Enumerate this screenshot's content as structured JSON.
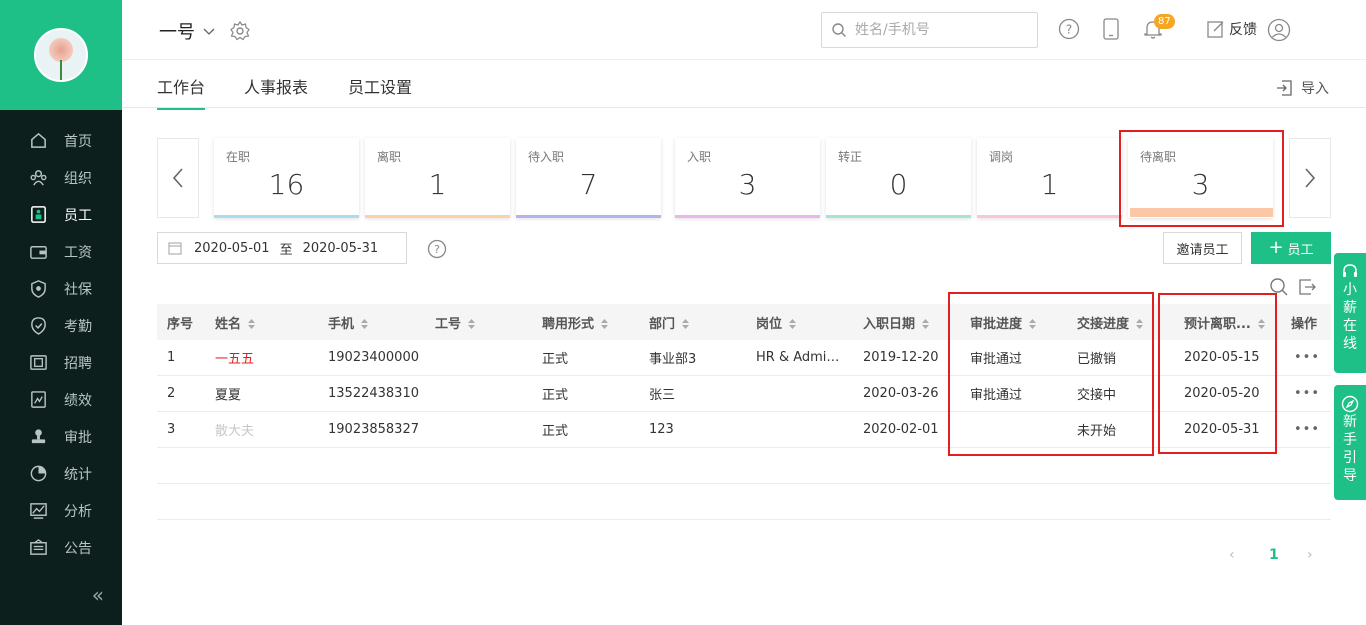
{
  "sidebar": {
    "items": [
      {
        "label": "首页",
        "icon": "home-icon"
      },
      {
        "label": "组织",
        "icon": "org-icon"
      },
      {
        "label": "员工",
        "icon": "employee-icon",
        "active": true
      },
      {
        "label": "工资",
        "icon": "wallet-icon"
      },
      {
        "label": "社保",
        "icon": "shield-icon"
      },
      {
        "label": "考勤",
        "icon": "check-icon"
      },
      {
        "label": "招聘",
        "icon": "recruit-icon"
      },
      {
        "label": "绩效",
        "icon": "performance-icon"
      },
      {
        "label": "审批",
        "icon": "stamp-icon"
      },
      {
        "label": "统计",
        "icon": "pie-icon"
      },
      {
        "label": "分析",
        "icon": "analysis-icon"
      },
      {
        "label": "公告",
        "icon": "notice-icon"
      }
    ],
    "collapse": "«"
  },
  "header": {
    "org_name": "一号",
    "search_placeholder": "姓名/手机号",
    "notification_count": "87",
    "feedback": "反馈"
  },
  "tabs": [
    "工作台",
    "人事报表",
    "员工设置"
  ],
  "import_label": "导入",
  "cards": [
    {
      "label": "在职",
      "value": "16",
      "color": "#a9dcef"
    },
    {
      "label": "离职",
      "value": "1",
      "color": "#fbd2a8"
    },
    {
      "label": "待入职",
      "value": "7",
      "color": "#b3b4ee"
    },
    {
      "label": "入职",
      "value": "3",
      "color": "#e8b8ec"
    },
    {
      "label": "转正",
      "value": "0",
      "color": "#a8e2d4"
    },
    {
      "label": "调岗",
      "value": "1",
      "color": "#f7c6dc"
    },
    {
      "label": "待离职",
      "value": "3",
      "color": "#fbc7a7"
    }
  ],
  "date_range": {
    "start": "2020-05-01",
    "sep": "至",
    "end": "2020-05-31"
  },
  "buttons": {
    "invite": "邀请员工",
    "add": "员工"
  },
  "table": {
    "headers": [
      "序号",
      "姓名",
      "手机",
      "工号",
      "聘用形式",
      "部门",
      "岗位",
      "入职日期",
      "审批进度",
      "交接进度",
      "预计离职...",
      "操作"
    ],
    "rows": [
      {
        "no": "1",
        "name": "一五五",
        "phone": "19023400000",
        "empno": "",
        "type": "正式",
        "dept": "事业部3",
        "post": "HR & Admin ...",
        "date": "2019-12-20",
        "approval": "审批通过",
        "handover": "已撤销",
        "leave": "2020-05-15"
      },
      {
        "no": "2",
        "name": "夏夏",
        "phone": "13522438310",
        "empno": "",
        "type": "正式",
        "dept": "张三",
        "post": "",
        "date": "2020-03-26",
        "approval": "审批通过",
        "handover": "交接中",
        "leave": "2020-05-20"
      },
      {
        "no": "3",
        "name": "散大夫",
        "phone": "19023858327",
        "empno": "",
        "type": "正式",
        "dept": "123",
        "post": "",
        "date": "2020-02-01",
        "approval": "",
        "handover": "未开始",
        "leave": "2020-05-31"
      }
    ],
    "more": "•••"
  },
  "pager": {
    "prev": "‹",
    "page": "1",
    "next": "›"
  },
  "widgets": {
    "online": [
      "小",
      "薪",
      "在",
      "线"
    ],
    "guide": [
      "新",
      "手",
      "引",
      "导"
    ]
  },
  "colors": {
    "accent": "#1ec088",
    "highlight": "#e02020",
    "name_red": "#e02020"
  }
}
